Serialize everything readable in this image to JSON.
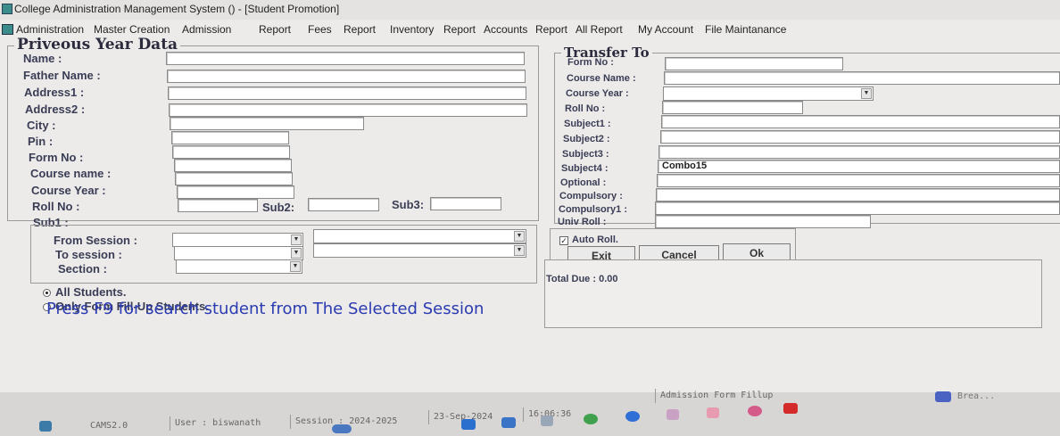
{
  "window": {
    "title": "College Administration Management System () - [Student Promotion]"
  },
  "menu": [
    "Administration",
    "Master Creation",
    "Admission",
    "Report",
    "Fees",
    "Report",
    "Inventory",
    "Report",
    "Accounts",
    "Report",
    "All Report",
    "My Account",
    "File Maintanance"
  ],
  "previous": {
    "title": "Priveous Year Data",
    "labels": {
      "name": "Name :",
      "father": "Father Name :",
      "address1": "Address1 :",
      "address2": "Address2 :",
      "city": "City :",
      "pin": "Pin :",
      "form_no": "Form No :",
      "course_name": "Course name :",
      "course_year": "Course Year :",
      "roll_no": "Roll No :",
      "sub1": "Sub1 :",
      "sub2": "Sub2:",
      "sub3": "Sub3:"
    },
    "values": {
      "name": "",
      "father": "",
      "address1": "",
      "address2": "",
      "city": "",
      "pin": "",
      "form_no": "",
      "course_name": "",
      "course_year": "",
      "roll_no": "",
      "sub1": "",
      "sub2": "",
      "sub3": ""
    }
  },
  "session": {
    "from_label": "From Session :",
    "to_label": "To session :",
    "section_label": "Section :",
    "from_value": "",
    "to_value": "",
    "section_value": "",
    "extra1": "",
    "extra2": ""
  },
  "options": {
    "all_students": "All Students.",
    "only_form": "Only Form Fill-Up Students.",
    "selected": "all_students",
    "hint": "Press F9 for search student from The Selected Session"
  },
  "transfer": {
    "title": "Transfer To",
    "labels": {
      "form_no": "Form No :",
      "course_name": "Course Name :",
      "course_year": "Course Year :",
      "roll_no": "Roll No :",
      "subject1": "Subject1 :",
      "subject2": "Subject2 :",
      "subject3": "Subject3 :",
      "subject4": "Subject4 :",
      "optional": "Optional :",
      "compulsory": "Compulsory :",
      "compulsory1": "Compulsory1 :",
      "univ_roll": "Univ Roll :"
    },
    "values": {
      "form_no": "",
      "course_name": "",
      "course_year": "",
      "roll_no": "",
      "subject1": "",
      "subject2": "",
      "subject3": "",
      "subject4": "Combo15",
      "optional": "",
      "compulsory": "",
      "compulsory1": "",
      "univ_roll": ""
    }
  },
  "actions": {
    "auto_roll": "Auto Roll.",
    "auto_roll_checked": true,
    "exit": "Exit",
    "cancel": "Cancel",
    "ok": "Ok",
    "total_due": "Total Due : 0.00"
  },
  "status": {
    "app": "CAMS2.0",
    "user": "User : biswanath",
    "session": "Session : 2024-2025",
    "date": "23-Sep-2024",
    "time": "16:06:36",
    "module": "Admission Form Fillup"
  },
  "taskbar": {
    "news": "Brea..."
  },
  "colors": {
    "background": "#ecebea",
    "hint": "#2a3ab0",
    "label": "#3a3d55"
  }
}
